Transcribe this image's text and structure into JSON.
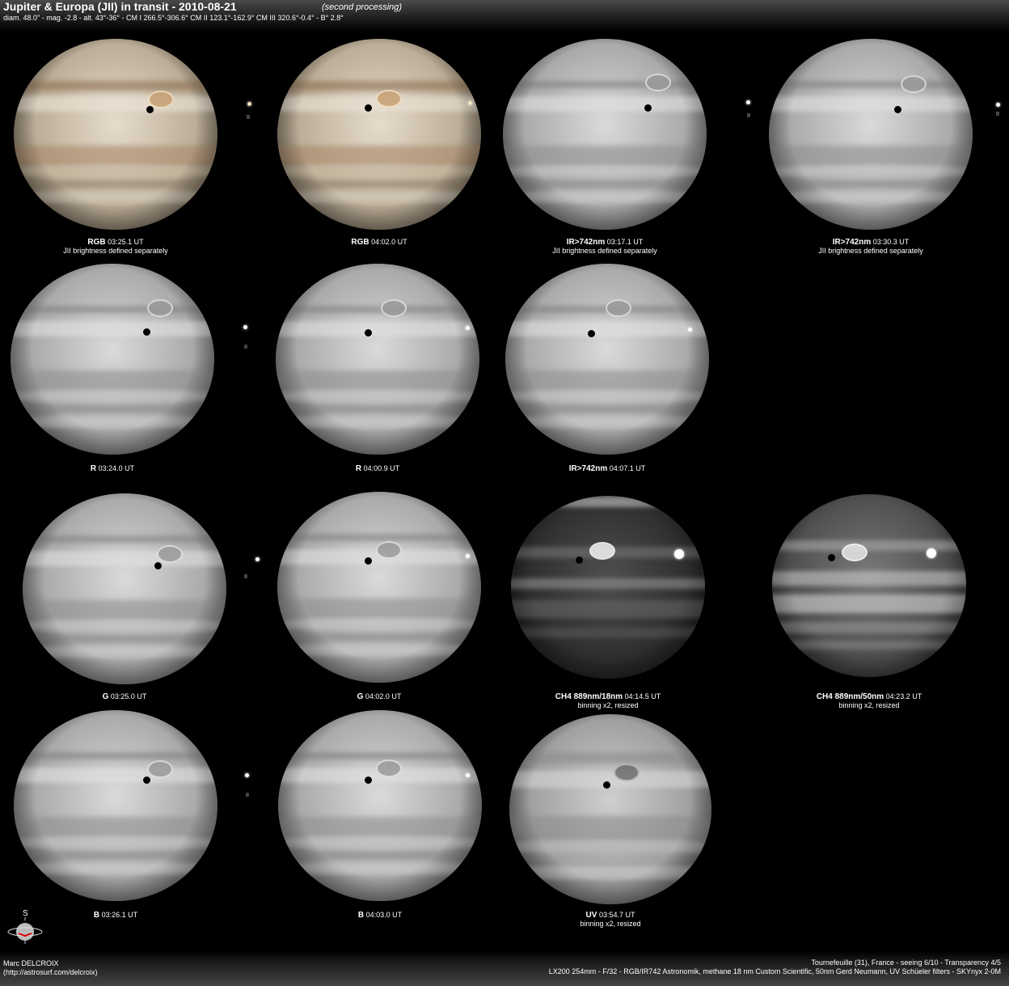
{
  "header": {
    "title": "Jupiter & Europa (JII) in transit - 2010-08-21",
    "subtitle": "(second processing)",
    "info": "diam. 48.0\" - mag. -2.8 - alt. 43°-36° - CM I 266.5°-306.6° CM II 123.1°-162.9° CM III 320.6°-0.4° - B° 2.8°"
  },
  "panels": [
    {
      "filter": "RGB",
      "time": "03:25.1 UT",
      "note": "JII brightness defined separately",
      "marker": "II"
    },
    {
      "filter": "RGB",
      "time": "04:02.0 UT",
      "note": "",
      "marker": ""
    },
    {
      "filter": "IR>742nm",
      "time": "03:17.1 UT",
      "note": "JII brightness defined separately",
      "marker": "II"
    },
    {
      "filter": "IR>742nm",
      "time": "03:30.3 UT",
      "note": "JII brightness defined separately",
      "marker": "II"
    },
    {
      "filter": "R",
      "time": "03:24.0 UT",
      "note": "",
      "marker": "II"
    },
    {
      "filter": "R",
      "time": "04:00.9 UT",
      "note": "",
      "marker": ""
    },
    {
      "filter": "IR>742nm",
      "time": "04:07.1 UT",
      "note": "",
      "marker": ""
    },
    {
      "filter": "G",
      "time": "03:25.0 UT",
      "note": "",
      "marker": "II"
    },
    {
      "filter": "G",
      "time": "04:02.0 UT",
      "note": "",
      "marker": ""
    },
    {
      "filter": "CH4 889nm/18nm",
      "time": "04:14.5 UT",
      "note": "binning x2, resized",
      "marker": ""
    },
    {
      "filter": "CH4 889nm/50nm",
      "time": "04:23.2 UT",
      "note": "binning x2, resized",
      "marker": ""
    },
    {
      "filter": "B",
      "time": "03:26.1 UT",
      "note": "",
      "marker": "II"
    },
    {
      "filter": "B",
      "time": "04:03.0 UT",
      "note": "",
      "marker": ""
    },
    {
      "filter": "UV",
      "time": "03:54.7 UT",
      "note": "binning x2, resized",
      "marker": ""
    }
  ],
  "compass": {
    "label": "S"
  },
  "footer": {
    "author_name": "Marc DELCROIX",
    "author_url": "(http://astrosurf.com/delcroix)",
    "location": "Tournefeuille (31), France - seeing 6/10 - Transparency 4/5",
    "equipment": "LX200 254mm - F/32 -  RGB/IR742 Astronomik, methane 18 nm Custom Scientific, 50nm Gerd Neumann, UV Schüeler filters - SKYnyx 2-0M"
  },
  "colors": {
    "background": "#000000",
    "text": "#ffffff"
  }
}
